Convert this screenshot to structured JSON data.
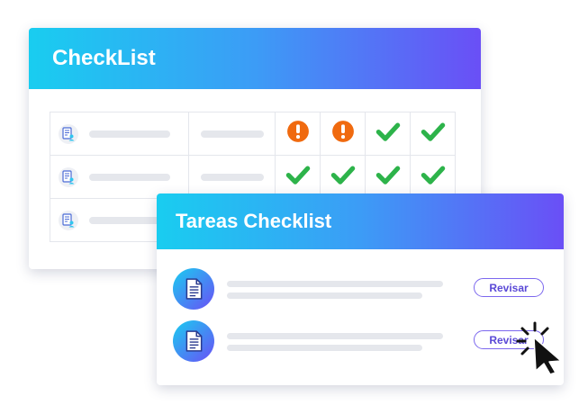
{
  "checklist_card": {
    "title": "CheckList",
    "rows": [
      {
        "statuses": [
          "warning",
          "warning",
          "check",
          "check"
        ]
      },
      {
        "statuses": [
          "check",
          "check",
          "check",
          "check"
        ]
      },
      {
        "statuses": []
      }
    ]
  },
  "tasks_card": {
    "title": "Tareas Checklist",
    "items": [
      {
        "button_label": "Revisar"
      },
      {
        "button_label": "Revisar"
      }
    ]
  },
  "colors": {
    "header_gradient": [
      "#19cdf0",
      "#3c9cf6",
      "#6a4ff6"
    ],
    "check": "#2db34a",
    "warning": "#f06a0f",
    "button_text": "#5a49d6"
  },
  "icons": {
    "row_icon": "document-person-icon",
    "task_icon": "document-icon",
    "cursor": "arrow-cursor-click-icon"
  }
}
